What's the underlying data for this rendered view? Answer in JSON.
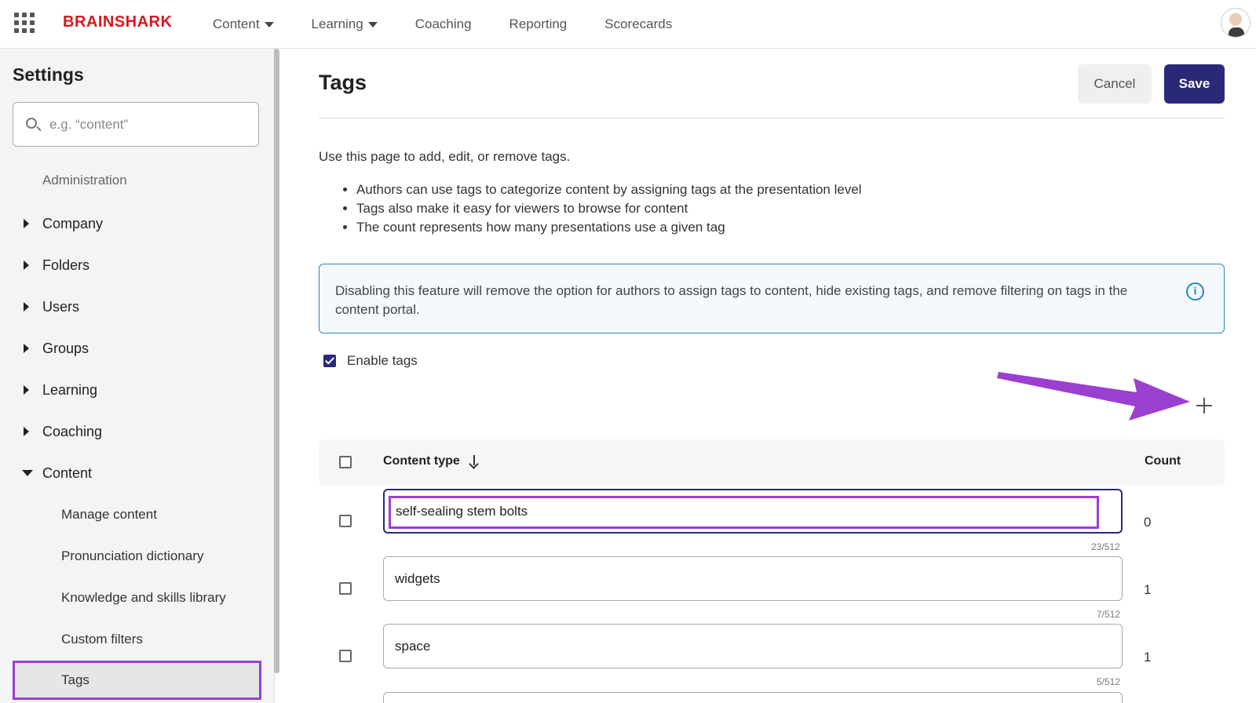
{
  "header": {
    "logo": "BRAINSHARK",
    "nav": [
      {
        "label": "Content",
        "has_caret": true
      },
      {
        "label": "Learning",
        "has_caret": true
      },
      {
        "label": "Coaching",
        "has_caret": false
      },
      {
        "label": "Reporting",
        "has_caret": false
      },
      {
        "label": "Scorecards",
        "has_caret": false
      }
    ],
    "brand_color": "#d71920"
  },
  "sidebar": {
    "title": "Settings",
    "search_placeholder": "e.g. “content”",
    "section": "Administration",
    "items": [
      {
        "label": "Company",
        "expanded": false
      },
      {
        "label": "Folders",
        "expanded": false
      },
      {
        "label": "Users",
        "expanded": false
      },
      {
        "label": "Groups",
        "expanded": false
      },
      {
        "label": "Learning",
        "expanded": false
      },
      {
        "label": "Coaching",
        "expanded": false
      },
      {
        "label": "Content",
        "expanded": true
      }
    ],
    "sub_items": [
      {
        "label": "Manage content"
      },
      {
        "label": "Pronunciation dictionary"
      },
      {
        "label": "Knowledge and skills library"
      },
      {
        "label": "Custom filters"
      }
    ],
    "active_item": "Tags"
  },
  "main": {
    "title": "Tags",
    "cancel_label": "Cancel",
    "save_label": "Save",
    "intro": "Use this page to add, edit, or remove tags.",
    "bullets": [
      "Authors can use tags to categorize content by assigning tags at the presentation level",
      "Tags also make it easy for viewers to browse for content",
      "The count represents how many presentations use a given tag"
    ],
    "info_text": "Disabling this feature will remove the option for authors to assign tags to content, hide existing tags, and remove filtering on tags in the content portal.",
    "enable_label": "Enable tags",
    "enable_checked": true,
    "table": {
      "col_content_type": "Content type",
      "col_count": "Count",
      "rows": [
        {
          "value": "self-sealing stem bolts",
          "counter": "23/512",
          "count": "0"
        },
        {
          "value": "widgets",
          "counter": "7/512",
          "count": "1"
        },
        {
          "value": "space",
          "counter": "5/512",
          "count": "1"
        }
      ]
    },
    "accent_color": "#2a2978",
    "highlight_color": "#9b3fd0"
  }
}
